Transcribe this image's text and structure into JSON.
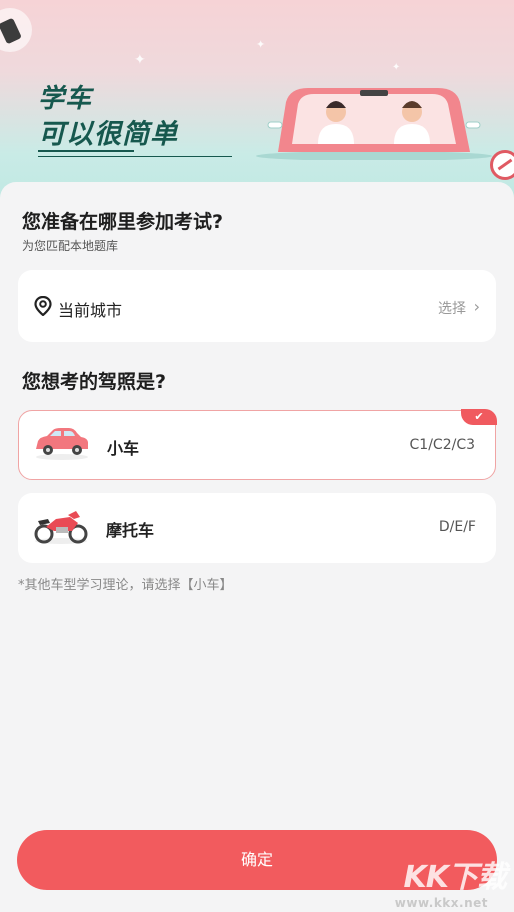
{
  "banner": {
    "title_line1": "学车",
    "title_line2": "可以很简单"
  },
  "location": {
    "heading": "您准备在哪里参加考试?",
    "subheading": "为您匹配本地题库",
    "city_label": "当前城市",
    "select_label": "选择"
  },
  "license": {
    "heading": "您想考的驾照是?",
    "options": [
      {
        "name": "小车",
        "code": "C1/C2/C3",
        "selected": true
      },
      {
        "name": "摩托车",
        "code": "D/E/F",
        "selected": false
      }
    ],
    "note": "*其他车型学习理论，请选择【小车】"
  },
  "confirm_label": "确定",
  "watermark": {
    "big": "KK下载",
    "small": "www.kkx.net"
  },
  "colors": {
    "accent": "#f25b5e",
    "banner_text": "#16584e",
    "selected_border": "#f0a4a4"
  }
}
